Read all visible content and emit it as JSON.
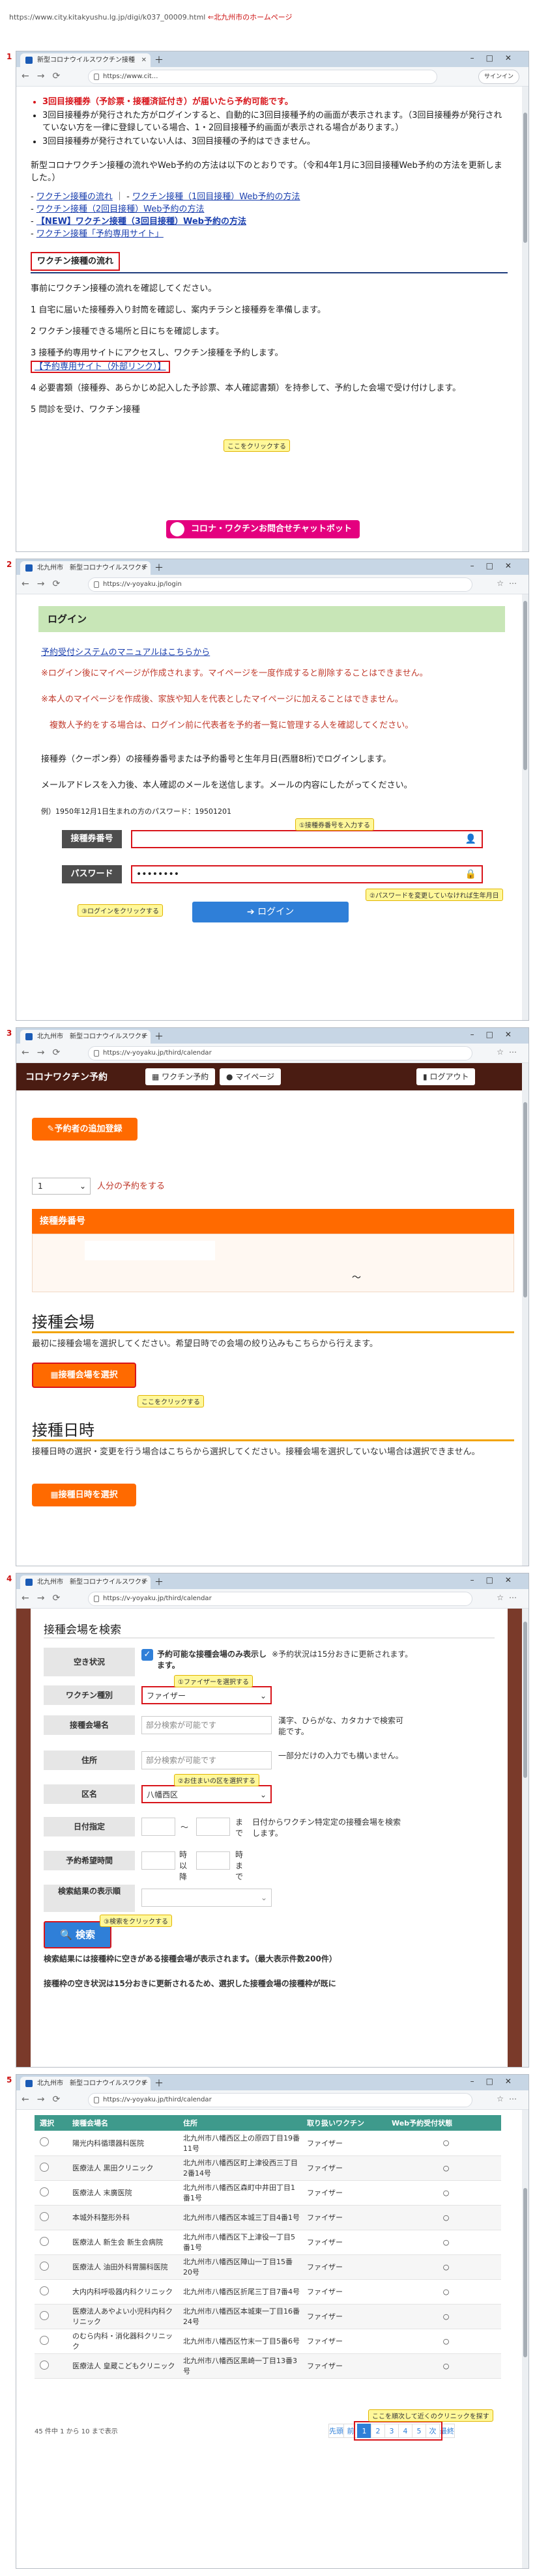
{
  "header": {
    "url": "https://www.city.kitakyushu.lg.jp/digi/k037_00009.html",
    "note": "⇐北九州市のホームページ"
  },
  "steps": [
    "1",
    "2",
    "3",
    "4",
    "5"
  ],
  "browser": {
    "tab_title": "新型コロナウイルスワクチン接種",
    "tab_title_short": "北九州市　新型コロナウイルスワクチ",
    "signin_label": "サインイン",
    "url_city": "https://www.cit...",
    "url_login": "https://v-yoyaku.jp/login",
    "url_calendar": "https://v-yoyaku.jp/third/calendar"
  },
  "step1": {
    "bullets": [
      "3回目接種券（予診票・接種済証付き）が届いたら予約可能です。",
      "3回目接種券が発行された方がログインすると、自動的に3回目接種予約の画面が表示されます。（3回目接種券が発行されていない方を一律に登録している場合、1・2回目接種予約画面が表示される場合があります。）",
      "3回目接種券が発行されていない人は、3回目接種の予約はできません。"
    ],
    "intro": "新型コロナワクチン接種の流れやWeb予約の方法は以下のとおりです。（令和4年1月に3回目接種Web予約の方法を更新しました。）",
    "links": [
      "ワクチン接種の流れ",
      "ワクチン接種（1回目接種）Web予約の方法",
      "ワクチン接種（2回目接種）Web予約の方法",
      "【NEW】ワクチン接種（3回目接種）Web予約の方法",
      "ワクチン接種「予約専用サイト」"
    ],
    "section_title": "ワクチン接種の流れ",
    "flow_intro": "事前にワクチン接種の流れを確認してください。",
    "flow": [
      "1 自宅に届いた接種券入り封筒を確認し、案内チラシと接種券を準備します。",
      "2 ワクチン接種できる場所と日にちを確認します。",
      "3 接種予約専用サイトにアクセスし、ワクチン接種を予約します。",
      "【予約専用サイト（外部リンク）】",
      "4 必要書類（接種券、あらかじめ記入した予診票、本人確認書類）を持参して、予約した会場で受け付けします。",
      "5 問診を受け、ワクチン接種"
    ],
    "callout": "ここをクリックする",
    "chatbot": "コロナ・ワクチンお問合せチャットボット"
  },
  "step2": {
    "title": "ログイン",
    "manual": "予約受付システムのマニュアルはこちらから",
    "notes": [
      "※ログイン後にマイページが作成されます。マイページを一度作成すると削除することはできません。",
      "※本人のマイページを作成後、家族や知人を代表としたマイページに加えることはできません。",
      "　複数人予約をする場合は、ログイン前に代表者を予約者一覧に管理する人を確認してください。"
    ],
    "desc1": "接種券（クーポン券）の接種券番号または予約番号と生年月日(西暦8桁)でログインします。",
    "desc2": "メールアドレスを入力後、本人確認のメールを送信します。メールの内容にしたがってください。",
    "example": "例）1950年12月1日生まれの方のパスワード：19501201",
    "ticket_label": "接種券番号",
    "password_label": "パスワード",
    "password_value": "••••••••",
    "login_button": "ログイン",
    "callout_ticket": "①接種券番号を入力する",
    "callout_password": "②パスワードを変更していなければ生年月日",
    "callout_login": "③ログインをクリックする"
  },
  "step3": {
    "brand": "コロナワクチン予約",
    "nav": [
      "ワクチン予約",
      "マイページ",
      "ログアウト"
    ],
    "add_person": "予約者の追加登録",
    "count_value": "1",
    "count_suffix": "人分の予約をする",
    "ticket_bar": "接種券番号",
    "tilde": "～",
    "venue_heading": "接種会場",
    "venue_desc": "最初に接種会場を選択してください。希望日時での会場の絞り込みもこちらから行えます。",
    "venue_button": "接種会場を選択",
    "callout": "ここをクリックする",
    "date_heading": "接種日時",
    "date_desc": "接種日時の選択・変更を行う場合はこちらから選択してください。接種会場を選択していない場合は選択できません。",
    "date_button": "接種日時を選択"
  },
  "step4": {
    "title": "接種会場を検索",
    "labels": [
      "空き状況",
      "ワクチン種別",
      "接種会場名",
      "住所",
      "区名",
      "日付指定",
      "予約希望時間",
      "検索結果の表示順"
    ],
    "availability": "予約可能な接種会場のみ表示します。",
    "availability_note": "※予約状況は15分おきに更新されます。",
    "vaccine_value": "ファイザー",
    "venue_placeholder": "部分検索が可能です",
    "venue_hint": "漢字、ひらがな、カタカナで検索可能です。",
    "address_placeholder": "部分検索が可能です",
    "address_hint": "一部分だけの入力でも構いません。",
    "ward_value": "八幡西区",
    "date_sep": "〜",
    "date_suffix": "まで",
    "date_hint": "日付からワクチン特定定の接種会場を検索します。",
    "time_from": "時以降",
    "time_to": "時まで",
    "search_button": "検索",
    "result_note": "検索結果には接種枠に空きがある接種会場が表示されます。（最大表示件数200件）",
    "result_note2": "接種枠の空き状況は15分おきに更新されるため、選択した接種会場の接種枠が既に",
    "callout_vaccine": "①ファイザーを選択する",
    "callout_ward": "②お住まいの区を選択する",
    "callout_search": "③検索をクリックする"
  },
  "step5": {
    "headers": [
      "選択",
      "接種会場名",
      "住所",
      "取り扱いワクチン",
      "Web予約受付状態"
    ],
    "rows": [
      {
        "name": "陽光内科循環器科医院",
        "addr": "北九州市八幡西区上の原四丁目19番11号",
        "vac": "ファイザー",
        "status": "○"
      },
      {
        "name": "医療法人 黒田クリニック",
        "addr": "北九州市八幡西区町上津役西三丁目2番14号",
        "vac": "ファイザー",
        "status": "○"
      },
      {
        "name": "医療法人 末廣医院",
        "addr": "北九州市八幡西区森町中井田丁目1番1号",
        "vac": "ファイザー",
        "status": "○"
      },
      {
        "name": "本城外科整形外科",
        "addr": "北九州市八幡西区本城三丁目4番1号",
        "vac": "ファイザー",
        "status": "○"
      },
      {
        "name": "医療法人 新生会 新生会病院",
        "addr": "北九州市八幡西区下上津役一丁目5番1号",
        "vac": "ファイザー",
        "status": "○"
      },
      {
        "name": "医療法人 油田外科胃腸科医院",
        "addr": "北九州市八幡西区陣山一丁目15番20号",
        "vac": "ファイザー",
        "status": "○"
      },
      {
        "name": "大内内科呼吸器内科クリニック",
        "addr": "北九州市八幡西区折尾三丁目7番4号",
        "vac": "ファイザー",
        "status": "○"
      },
      {
        "name": "医療法人あやよい小児科内科クリニック",
        "addr": "北九州市八幡西区本城東一丁目16番24号",
        "vac": "ファイザー",
        "status": "○"
      },
      {
        "name": "のむら内科・消化器科クリニック",
        "addr": "北九州市八幡西区竹末一丁目5番6号",
        "vac": "ファイザー",
        "status": "○"
      },
      {
        "name": "医療法人 皇蔵こどもクリニック",
        "addr": "北九州市八幡西区黒崎一丁目13番3号",
        "vac": "ファイザー",
        "status": "○"
      }
    ],
    "count_text": "45 件中 1 から 10 まで表示",
    "pager": [
      "先頭",
      "前",
      "1",
      "2",
      "3",
      "4",
      "5",
      "次",
      "最終"
    ],
    "callout": "ここを順次して近くのクリニックを探す"
  }
}
